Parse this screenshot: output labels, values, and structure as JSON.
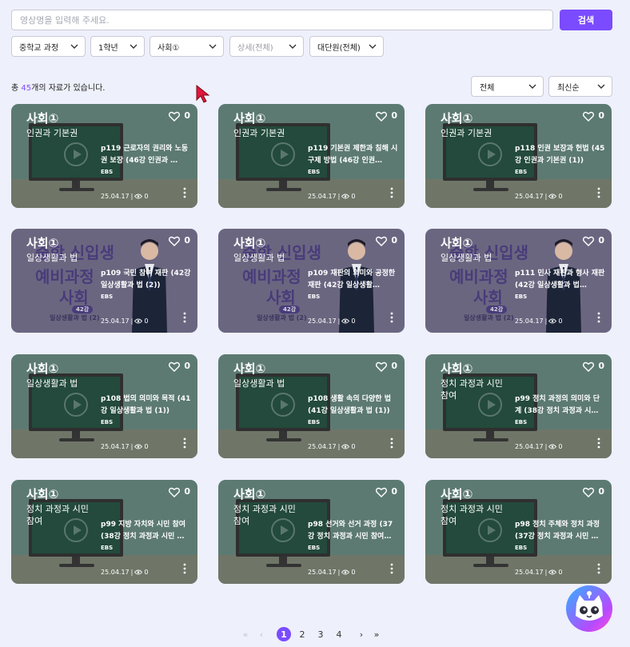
{
  "search": {
    "placeholder": "영상명을 입력해 주세요.",
    "button_label": "검색"
  },
  "filters": [
    {
      "label": "중학교 과정",
      "enabled": true
    },
    {
      "label": "1학년",
      "enabled": true
    },
    {
      "label": "사회①",
      "enabled": true
    },
    {
      "label": "상세(전체)",
      "enabled": false
    },
    {
      "label": "대단원(전체)",
      "enabled": true
    }
  ],
  "results": {
    "prefix": "총 ",
    "count": "45",
    "suffix": "개의 자료가 있습니다."
  },
  "sort": {
    "scope": "전체",
    "order": "최신순"
  },
  "cards": [
    {
      "subject": "사회①",
      "likes": "0",
      "unit": "인권과 기본권",
      "lesson": "p119 근로자의 권리와 노동권 보장 (46강 인권과 …",
      "brand": "EBS",
      "date": "25.04.17",
      "views": "0",
      "promo": false
    },
    {
      "subject": "사회①",
      "likes": "0",
      "unit": "인권과 기본권",
      "lesson": "p119 기본권 제한과 침해 시 구제 방법 (46강 인권…",
      "brand": "EBS",
      "date": "25.04.17",
      "views": "0",
      "promo": false
    },
    {
      "subject": "사회①",
      "likes": "0",
      "unit": "인권과 기본권",
      "lesson": "p118 인권 보장과 헌법 (45강 인권과 기본권 (1))",
      "brand": "EBS",
      "date": "25.04.17",
      "views": "0",
      "promo": false
    },
    {
      "subject": "사회①",
      "likes": "0",
      "unit": "일상생활과 법",
      "lesson": "p109 국민 참여 재판 (42강 일상생활과 법 (2))",
      "brand": "EBS",
      "date": "25.04.17",
      "views": "0",
      "promo": true
    },
    {
      "subject": "사회①",
      "likes": "0",
      "unit": "일상생활과 법",
      "lesson": "p109 재판의 의미와 공정한 재판 (42강 일상생활…",
      "brand": "EBS",
      "date": "25.04.17",
      "views": "0",
      "promo": true
    },
    {
      "subject": "사회①",
      "likes": "0",
      "unit": "일상생활과 법",
      "lesson": "p111 민사 재판과 형사 재판 (42강 일상생활과 법…",
      "brand": "EBS",
      "date": "25.04.17",
      "views": "0",
      "promo": true
    },
    {
      "subject": "사회①",
      "likes": "0",
      "unit": "일상생활과 법",
      "lesson": "p108 법의 의미와 목적 (41강 일상생활과 법 (1))",
      "brand": "EBS",
      "date": "25.04.17",
      "views": "0",
      "promo": false
    },
    {
      "subject": "사회①",
      "likes": "0",
      "unit": "일상생활과 법",
      "lesson": "p108 생활 속의 다양한 법 (41강 일상생활과 법 (1))",
      "brand": "EBS",
      "date": "25.04.17",
      "views": "0",
      "promo": false
    },
    {
      "subject": "사회①",
      "likes": "0",
      "unit": "정치 과정과 시민 참여",
      "lesson": "p99 정치 과정의 의미와 단계 (38강 정치 과정과 시…",
      "brand": "EBS",
      "date": "25.04.17",
      "views": "0",
      "promo": false
    },
    {
      "subject": "사회①",
      "likes": "0",
      "unit": "정치 과정과 시민 참여",
      "lesson": "p99 지방 자치와 시민 참여 (38강 정치 과정과 시민 …",
      "brand": "EBS",
      "date": "25.04.17",
      "views": "0",
      "promo": false
    },
    {
      "subject": "사회①",
      "likes": "0",
      "unit": "정치 과정과 시민 참여",
      "lesson": "p98 선거와 선거 과정 (37강 정치 과정과 시민 참여…",
      "brand": "EBS",
      "date": "25.04.17",
      "views": "0",
      "promo": false
    },
    {
      "subject": "사회①",
      "likes": "0",
      "unit": "정치 과정과 시민 참여",
      "lesson": "p98 정치 주체와 정치 과정 (37강 정치 과정과 시민 …",
      "brand": "EBS",
      "date": "25.04.17",
      "views": "0",
      "promo": false
    }
  ],
  "promo_thumbnail": {
    "line1": "중학 신입생",
    "line2": "예비과정",
    "line3": "사회",
    "badge": "42강",
    "sub": "일상생활과 법 (2)"
  },
  "pagination": {
    "first": "«",
    "prev": "‹",
    "pages": [
      "1",
      "2",
      "3",
      "4"
    ],
    "current": "1",
    "next": "›",
    "last": "»"
  },
  "colors": {
    "accent": "#7b4bff",
    "background": "#eef0fb"
  }
}
